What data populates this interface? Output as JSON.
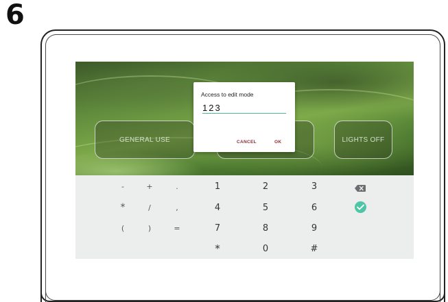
{
  "step": {
    "number": "6"
  },
  "scenes": {
    "general": "GENERAL USE",
    "middle": "",
    "lights_off": "LIGHTS OFF"
  },
  "dialog": {
    "title": "Access to edit mode",
    "input_value": "123",
    "cancel_label": "CANCEL",
    "ok_label": "OK",
    "accent_color": "#4fb59a",
    "button_color": "#8c2b3a"
  },
  "keyboard": {
    "rows": [
      [
        "-",
        "+",
        ".",
        "1",
        "2",
        "3"
      ],
      [
        "*",
        "/",
        ",",
        "4",
        "5",
        "6"
      ],
      [
        "(",
        ")",
        "=",
        "7",
        "8",
        "9"
      ],
      [
        "",
        "",
        "",
        "*",
        "0",
        "#"
      ]
    ],
    "backspace_icon": "backspace-icon",
    "confirm_icon": "check-circle-icon",
    "confirm_color": "#4fc4a7"
  }
}
